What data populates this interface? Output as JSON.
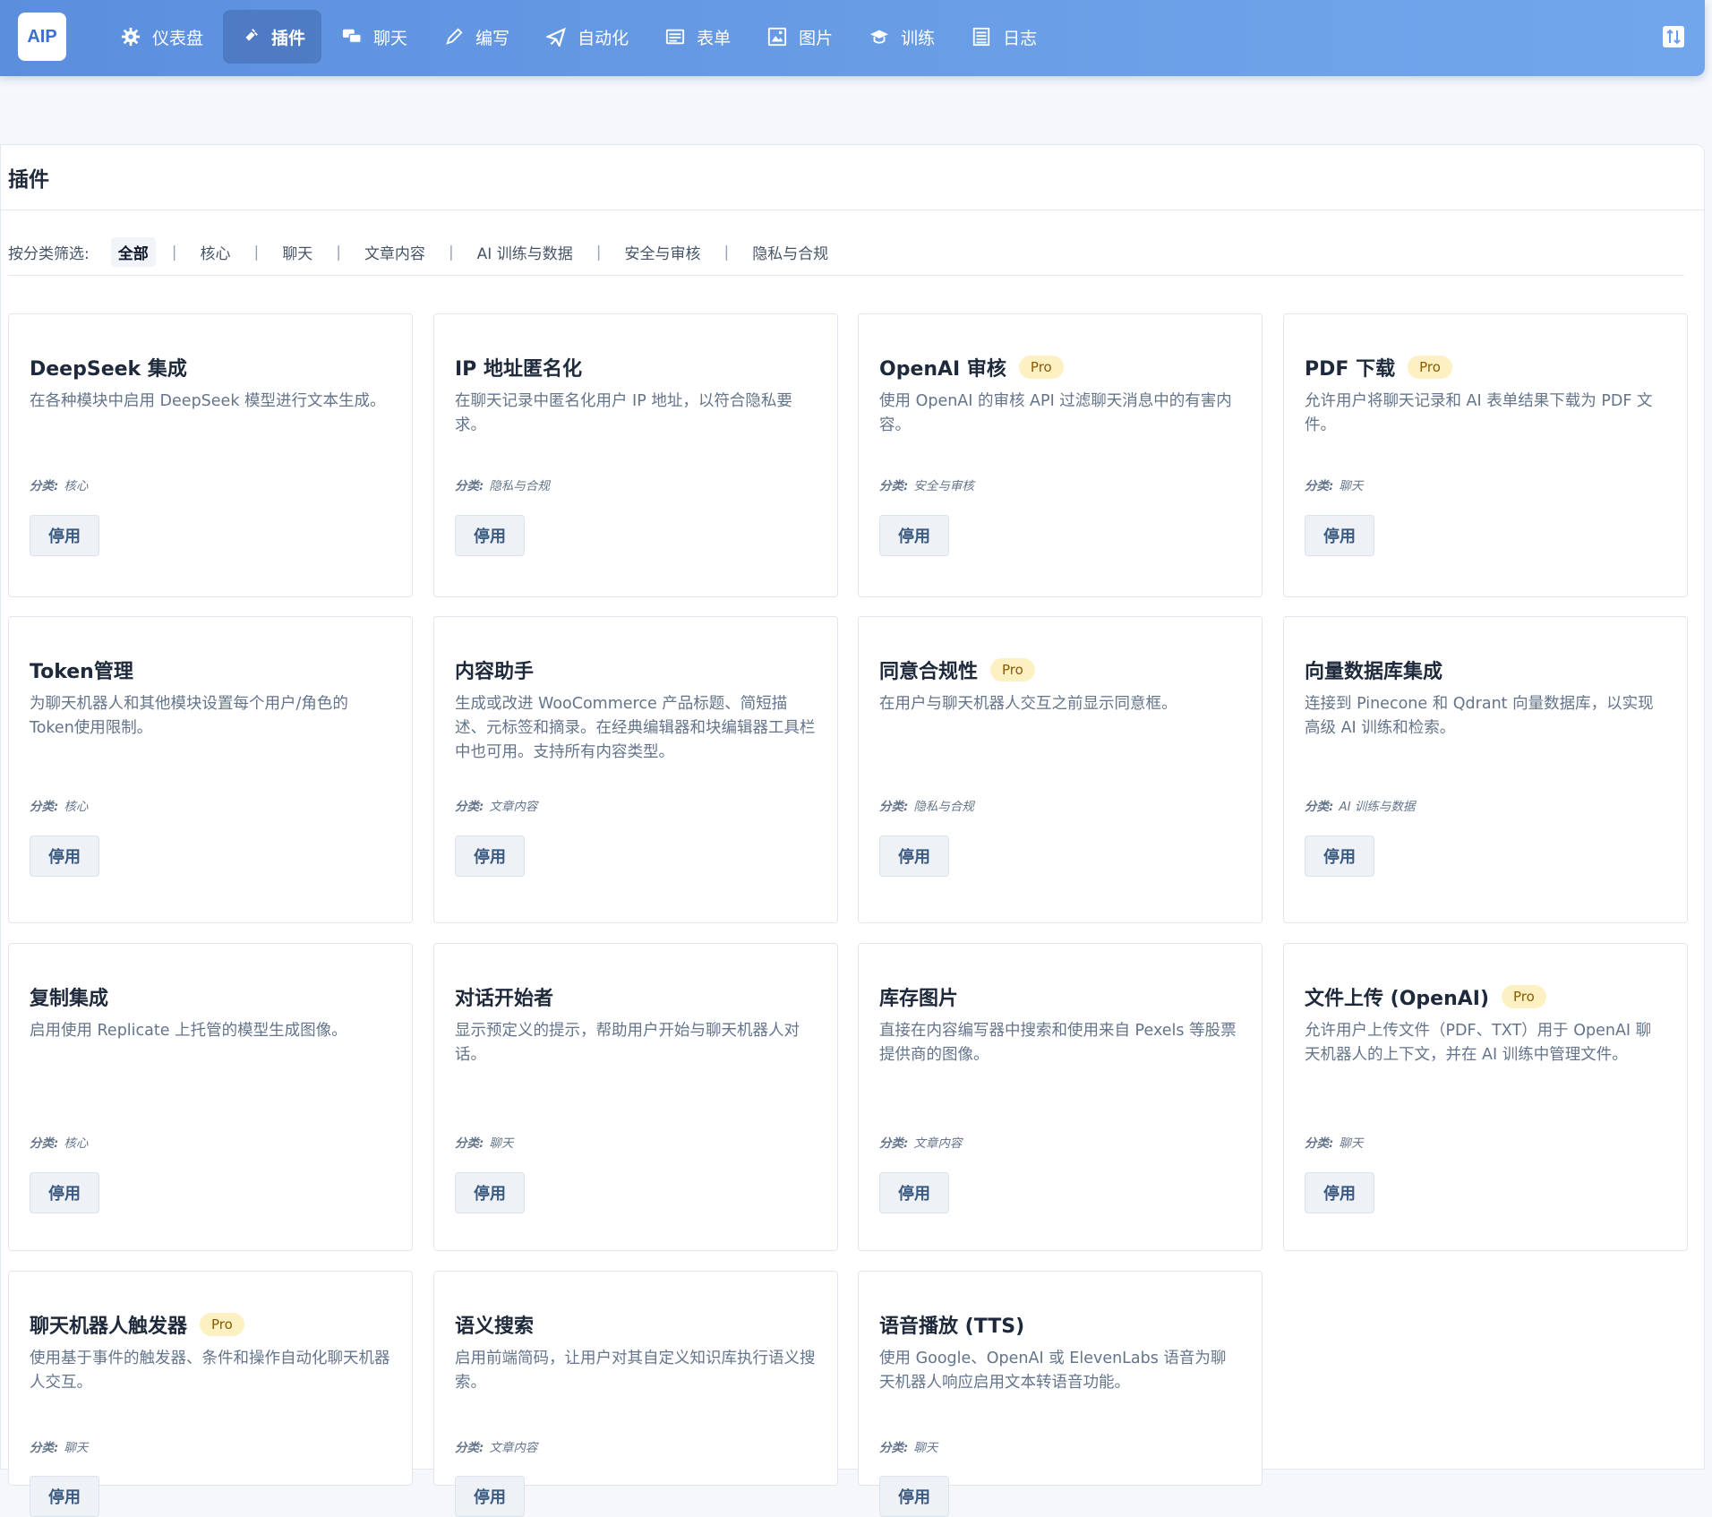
{
  "app": {
    "logo": "AIP"
  },
  "nav": [
    {
      "icon": "gear-icon",
      "label": "仪表盘",
      "active": false
    },
    {
      "icon": "plug-icon",
      "label": "插件",
      "active": true
    },
    {
      "icon": "chat-icon",
      "label": "聊天",
      "active": false
    },
    {
      "icon": "pencil-icon",
      "label": "编写",
      "active": false
    },
    {
      "icon": "plane-icon",
      "label": "自动化",
      "active": false
    },
    {
      "icon": "form-icon",
      "label": "表单",
      "active": false
    },
    {
      "icon": "image-icon",
      "label": "图片",
      "active": false
    },
    {
      "icon": "graduation-cap-icon",
      "label": "训练",
      "active": false
    },
    {
      "icon": "list-icon",
      "label": "日志",
      "active": false
    }
  ],
  "panel": {
    "title": "插件"
  },
  "filter": {
    "label": "按分类筛选:",
    "options": [
      "全部",
      "核心",
      "聊天",
      "文章内容",
      "AI 训练与数据",
      "安全与审核",
      "隐私与合规"
    ],
    "active_index": 0
  },
  "category_prefix": "分类:",
  "plugins": [
    {
      "title": "DeepSeek 集成",
      "pro": false,
      "desc": "在各种模块中启用 DeepSeek 模型进行文本生成。",
      "category": "核心",
      "button": "停用"
    },
    {
      "title": "IP 地址匿名化",
      "pro": false,
      "desc": "在聊天记录中匿名化用户 IP 地址，以符合隐私要求。",
      "category": "隐私与合规",
      "button": "停用"
    },
    {
      "title": "OpenAI 审核",
      "pro": true,
      "desc": "使用 OpenAI 的审核 API 过滤聊天消息中的有害内容。",
      "category": "安全与审核",
      "button": "停用"
    },
    {
      "title": "PDF 下载",
      "pro": true,
      "desc": "允许用户将聊天记录和 AI 表单结果下载为 PDF 文件。",
      "category": "聊天",
      "button": "停用"
    },
    {
      "title": "Token管理",
      "pro": false,
      "desc": "为聊天机器人和其他模块设置每个用户/角色的Token使用限制。",
      "category": "核心",
      "button": "停用"
    },
    {
      "title": "内容助手",
      "pro": false,
      "desc": "生成或改进 WooCommerce 产品标题、简短描述、元标签和摘录。在经典编辑器和块编辑器工具栏中也可用。支持所有内容类型。",
      "category": "文章内容",
      "button": "停用"
    },
    {
      "title": "同意合规性",
      "pro": true,
      "desc": "在用户与聊天机器人交互之前显示同意框。",
      "category": "隐私与合规",
      "button": "停用"
    },
    {
      "title": "向量数据库集成",
      "pro": false,
      "desc": "连接到 Pinecone 和 Qdrant 向量数据库，以实现高级 AI 训练和检索。",
      "category": "AI 训练与数据",
      "button": "停用"
    },
    {
      "title": "复制集成",
      "pro": false,
      "desc": "启用使用 Replicate 上托管的模型生成图像。",
      "category": "核心",
      "button": "停用"
    },
    {
      "title": "对话开始者",
      "pro": false,
      "desc": "显示预定义的提示，帮助用户开始与聊天机器人对话。",
      "category": "聊天",
      "button": "停用"
    },
    {
      "title": "库存图片",
      "pro": false,
      "desc": "直接在内容编写器中搜索和使用来自 Pexels 等股票提供商的图像。",
      "category": "文章内容",
      "button": "停用"
    },
    {
      "title": "文件上传 (OpenAI)",
      "pro": true,
      "desc": "允许用户上传文件（PDF、TXT）用于 OpenAI 聊天机器人的上下文，并在 AI 训练中管理文件。",
      "category": "聊天",
      "button": "停用"
    },
    {
      "title": "聊天机器人触发器",
      "pro": true,
      "desc": "使用基于事件的触发器、条件和操作自动化聊天机器人交互。",
      "category": "聊天",
      "button": "停用"
    },
    {
      "title": "语义搜索",
      "pro": false,
      "desc": "启用前端简码，让用户对其自定义知识库执行语义搜索。",
      "category": "文章内容",
      "button": "停用"
    },
    {
      "title": "语音播放 (TTS)",
      "pro": false,
      "desc": "使用 Google、OpenAI 或 ElevenLabs 语音为聊天机器人响应启用文本转语音功能。",
      "category": "聊天",
      "button": "停用"
    }
  ],
  "pro_label": "Pro"
}
